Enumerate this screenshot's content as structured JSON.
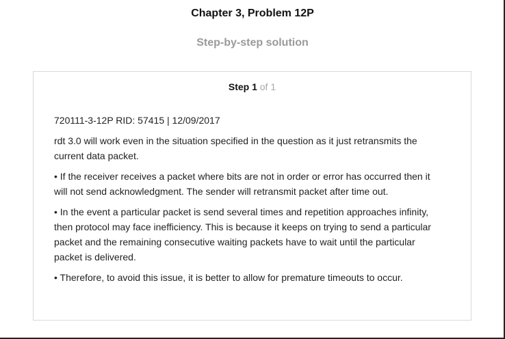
{
  "header": {
    "chapter_title": "Chapter 3, Problem 12P",
    "subtitle": "Step-by-step solution"
  },
  "step": {
    "label": "Step 1",
    "of_text": "of 1",
    "paragraphs": [
      "720111-3-12P RID: 57415 | 12/09/2017",
      "rdt 3.0 will work even in the situation specified in the question as it just retransmits the current data packet.",
      "• If the receiver receives a packet where bits are not in order or error has occurred then it will not send acknowledgment. The sender will retransmit packet after time out.",
      "• In the event a particular packet is send several times and repetition approaches infinity, then protocol may face inefficiency. This is because it keeps on trying to send a particular packet and the remaining consecutive waiting packets have to wait until the particular packet is delivered.",
      "• Therefore, to avoid this issue, it is better to allow for premature timeouts to occur."
    ]
  }
}
